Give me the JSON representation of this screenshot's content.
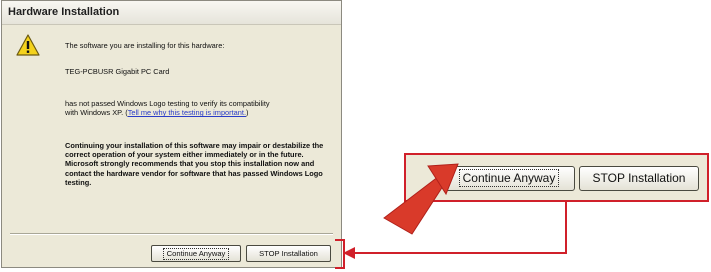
{
  "dialog": {
    "title": "Hardware Installation",
    "intro_text": "The software you are installing for this hardware:",
    "device_name": "TEG-PCBUSR Gigabit PC Card",
    "logo_text_1": "has not passed Windows Logo testing to verify its compatibility",
    "logo_text_2_prefix": "with Windows XP. (",
    "logo_link": "Tell me why this testing is important.",
    "logo_text_2_suffix": ")",
    "warning_text": "Continuing your installation of this software may impair or destabilize the correct operation of your system either immediately or in the future. Microsoft strongly recommends that you stop this installation now and contact the hardware vendor for software that has passed Windows Logo testing.",
    "buttons": {
      "continue_label": "Continue Anyway",
      "stop_label": "STOP Installation"
    }
  },
  "zoom": {
    "continue_label": "Continue Anyway",
    "stop_label": "STOP Installation"
  },
  "colors": {
    "accent_red": "#d0202a",
    "dialog_bg": "#ece9d8",
    "link": "#2a3cc8"
  },
  "icons": {
    "warning": "warning-icon",
    "arrow": "red-arrow-icon"
  }
}
